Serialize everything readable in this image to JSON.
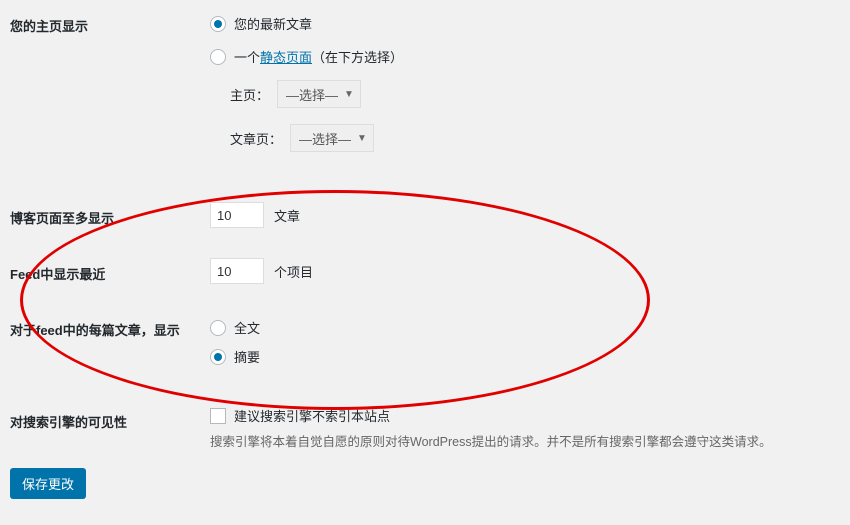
{
  "homepage": {
    "label": "您的主页显示",
    "opt_latest": "您的最新文章",
    "opt_static_prefix": "一个",
    "opt_static_link": "静态页面",
    "opt_static_suffix": "（在下方选择）",
    "front_label": "主页：",
    "front_value": "—选择—",
    "posts_label": "文章页：",
    "posts_value": "—选择—"
  },
  "blog_max": {
    "label": "博客页面至多显示",
    "value": "10",
    "unit": "文章"
  },
  "feed_max": {
    "label": "Feed中显示最近",
    "value": "10",
    "unit": "个项目"
  },
  "feed_each": {
    "label": "对于feed中的每篇文章，显示",
    "opt_full": "全文",
    "opt_summary": "摘要"
  },
  "search_vis": {
    "label": "对搜索引擎的可见性",
    "checkbox_label": "建议搜索引擎不索引本站点",
    "desc": "搜索引擎将本着自觉自愿的原则对待WordPress提出的请求。并不是所有搜索引擎都会遵守这类请求。"
  },
  "save_button": "保存更改"
}
